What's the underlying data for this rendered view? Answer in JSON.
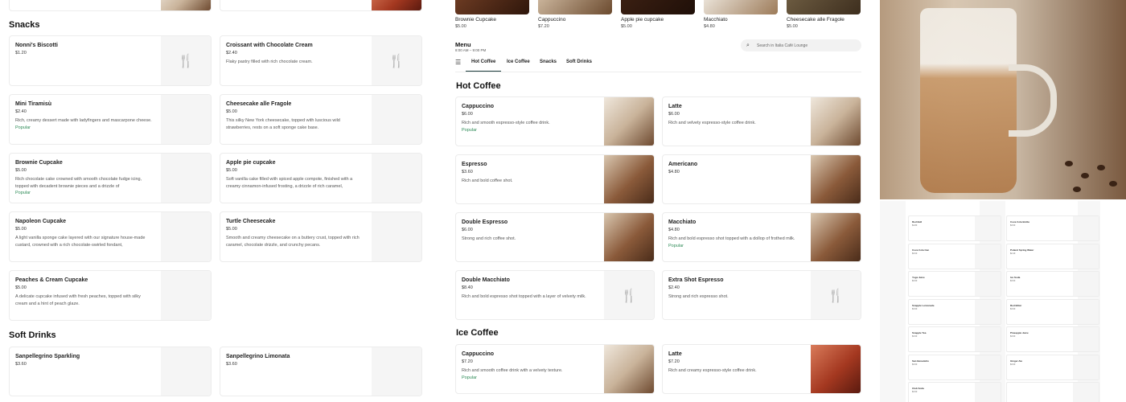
{
  "left_panel": {
    "snacks_title": "Snacks",
    "soft_drinks_title": "Soft Drinks",
    "snacks": [
      {
        "name": "Nonni's Biscotti",
        "price": "$1.20",
        "desc": "",
        "popular": "",
        "image": "fork-knife-icon"
      },
      {
        "name": "Croissant with Chocolate Cream",
        "price": "$2.40",
        "desc": "Flaky pastry filled with rich chocolate cream.",
        "popular": "",
        "image": "fork-knife-icon"
      },
      {
        "name": "Mini Tiramisù",
        "price": "$2.40",
        "desc": "Rich, creamy dessert made with ladyfingers and mascarpone cheese.",
        "popular": "Popular",
        "image": "blank"
      },
      {
        "name": "Cheesecake alle Fragole",
        "price": "$5.00",
        "desc": "This silky New York cheesecake, topped with luscious wild strawberries, rests on a soft sponge cake base.",
        "popular": "",
        "image": "blank"
      },
      {
        "name": "Brownie Cupcake",
        "price": "$5.00",
        "desc": "Rich chocolate cake crowned with smooth chocolate fudge icing, topped with decadent brownie pieces and a drizzle of",
        "popular": "Popular",
        "image": "blank"
      },
      {
        "name": "Apple pie cupcake",
        "price": "$5.00",
        "desc": "Soft vanilla cake filled with spiced apple compote, finished with a creamy cinnamon-infused frosting, a drizzle of rich caramel,",
        "popular": "",
        "image": "blank"
      },
      {
        "name": "Napoleon Cupcake",
        "price": "$5.00",
        "desc": "A light vanilla sponge cake layered with our signature house-made custard, crowned with a rich chocolate-swirled fondant,",
        "popular": "",
        "image": "blank"
      },
      {
        "name": "Turtle Cheesecake",
        "price": "$5.00",
        "desc": "Smooth and creamy cheesecake on a buttery crust, topped with rich caramel, chocolate drizzle, and crunchy pecans.",
        "popular": "",
        "image": "blank"
      },
      {
        "name": "Peaches & Cream Cupcake",
        "price": "$5.00",
        "desc": "A delicate cupcake infused with fresh peaches, topped with silky cream and a hint of peach glaze.",
        "popular": "",
        "image": "blank"
      }
    ],
    "soft_drinks": [
      {
        "name": "Sanpellegrino Sparkling",
        "price": "$3.60"
      },
      {
        "name": "Sanpellegrino Limonata",
        "price": "$3.60"
      }
    ]
  },
  "top_strip": [
    {
      "name": "Brownie Cupcake",
      "price": "$5.00"
    },
    {
      "name": "Cappuccino",
      "price": "$7.20"
    },
    {
      "name": "Apple pie cupcake",
      "price": "$5.00"
    },
    {
      "name": "Macchiato",
      "price": "$4.80"
    },
    {
      "name": "Cheesecake alle Fragole",
      "price": "$5.00"
    }
  ],
  "menu_header": {
    "title": "Menu",
    "hours": "8:00 AM – 9:00 PM",
    "search_placeholder": "Search in Italia Café Lounge"
  },
  "tabs": [
    "Hot Coffee",
    "Ice Coffee",
    "Snacks",
    "Soft Drinks"
  ],
  "hot_coffee": {
    "title": "Hot Coffee",
    "items": [
      {
        "name": "Cappuccino",
        "price": "$6.00",
        "desc": "Rich and smooth espresso-style coffee drink.",
        "popular": "Popular"
      },
      {
        "name": "Latte",
        "price": "$6.00",
        "desc": "Rich and velvety espresso-style coffee drink.",
        "popular": ""
      },
      {
        "name": "Espresso",
        "price": "$3.60",
        "desc": "Rich and bold coffee shot.",
        "popular": ""
      },
      {
        "name": "Americano",
        "price": "$4.80",
        "desc": "",
        "popular": ""
      },
      {
        "name": "Double Espresso",
        "price": "$6.00",
        "desc": "Strong and rich coffee shot.",
        "popular": ""
      },
      {
        "name": "Macchiato",
        "price": "$4.80",
        "desc": "Rich and bold espresso shot topped with a dollop of frothed milk.",
        "popular": "Popular"
      },
      {
        "name": "Double Macchiato",
        "price": "$8.40",
        "desc": "Rich and bold espresso shot topped with a layer of velvety milk.",
        "popular": ""
      },
      {
        "name": "Extra Shot Espresso",
        "price": "$2.40",
        "desc": "Strong and rich espresso shot.",
        "popular": ""
      }
    ]
  },
  "ice_coffee": {
    "title": "Ice Coffee",
    "items": [
      {
        "name": "Cappuccino",
        "price": "$7.20",
        "desc": "Rich and smooth coffee drink with a velvety texture.",
        "popular": "Popular"
      },
      {
        "name": "Latte",
        "price": "$7.20",
        "desc": "Rich and creamy espresso-style coffee drink.",
        "popular": ""
      }
    ]
  },
  "right_grid": [
    {
      "name": "Red Bull",
      "price": "$4.80"
    },
    {
      "name": "Coca Cola Bottle",
      "price": "$3.60"
    },
    {
      "name": "Coca Cola Can",
      "price": "$3.00"
    },
    {
      "name": "Poland Spring Water",
      "price": "$2.40"
    },
    {
      "name": "Yoga Juice",
      "price": "$3.60"
    },
    {
      "name": "Ice Soda",
      "price": "$3.60"
    },
    {
      "name": "Snapple Lemonade",
      "price": "$3.60"
    },
    {
      "name": "Red Bitter",
      "price": "$3.60"
    },
    {
      "name": "Snapple Tea",
      "price": "$3.60"
    },
    {
      "name": "Pineapple Juice",
      "price": "$3.60"
    },
    {
      "name": "San Benedetto",
      "price": "$3.60"
    },
    {
      "name": "Ginger Ale",
      "price": "$3.60"
    },
    {
      "name": "Club Soda",
      "price": "$3.60"
    },
    {
      "name": "",
      "price": ""
    }
  ]
}
